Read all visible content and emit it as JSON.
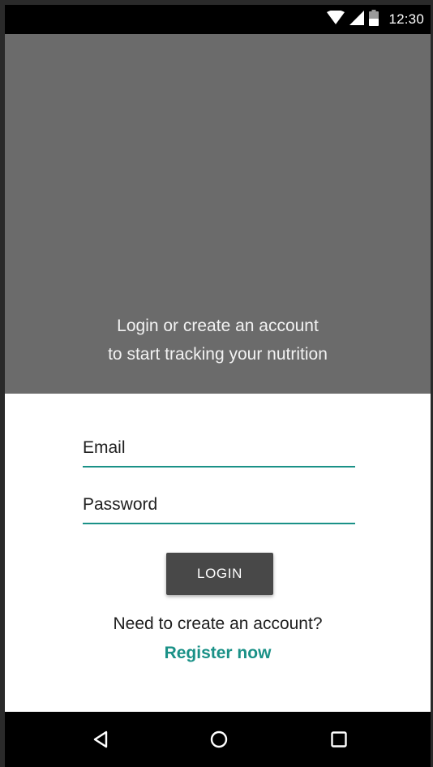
{
  "status_bar": {
    "time": "12:30",
    "icons": [
      "wifi-icon",
      "signal-icon",
      "battery-icon"
    ]
  },
  "hero": {
    "line1": "Login or create an account",
    "line2": "to start tracking your nutrition",
    "background_color": "#6b6b6b"
  },
  "form": {
    "email_placeholder": "Email",
    "password_placeholder": "Password",
    "login_label": "LOGIN",
    "prompt": "Need to create an account?",
    "register_label": "Register now",
    "accent_color": "#1a9187"
  },
  "nav_bar": {
    "icons": [
      "back-icon",
      "home-icon",
      "recents-icon"
    ]
  }
}
